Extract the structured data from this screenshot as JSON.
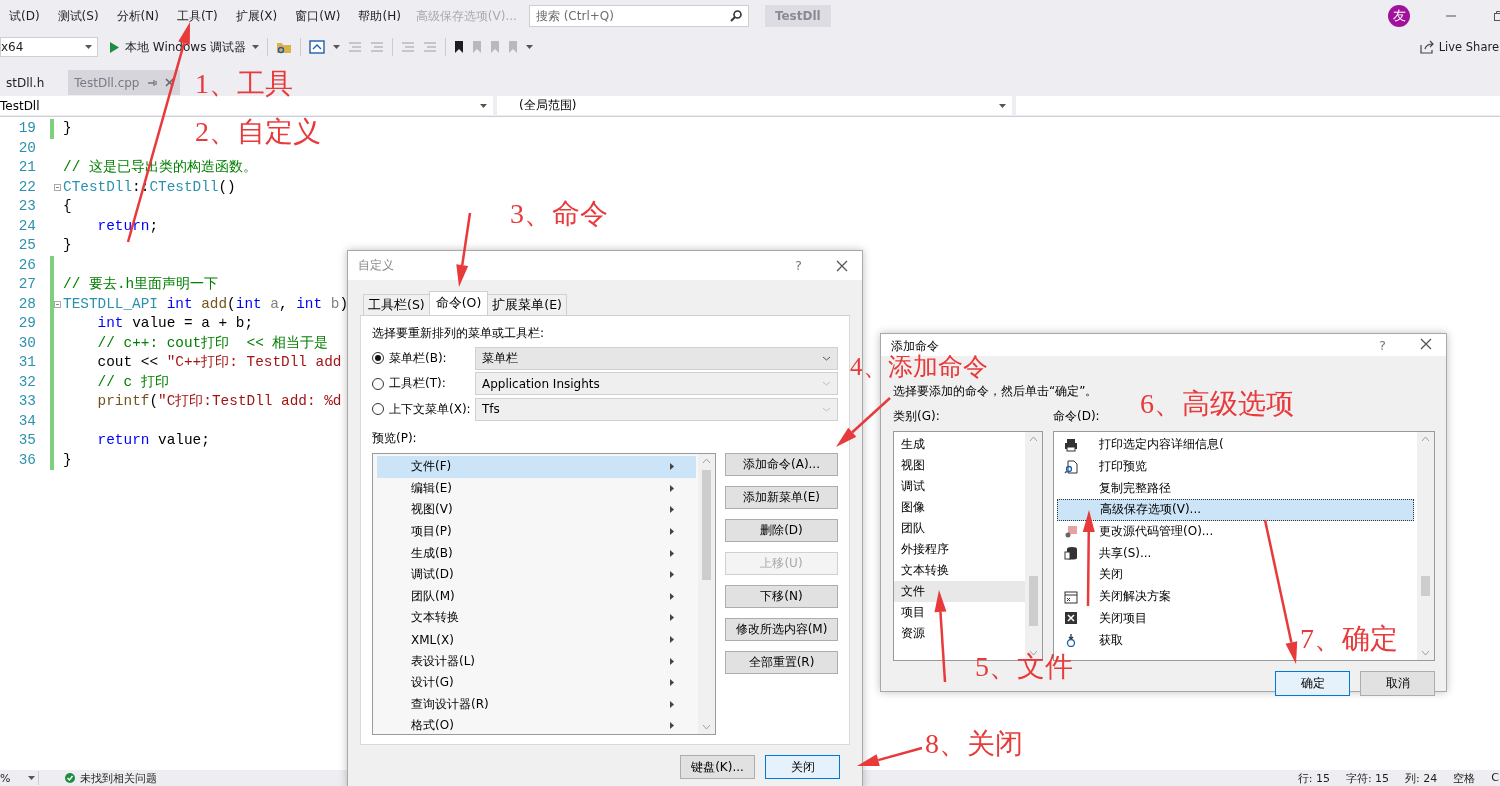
{
  "menubar": {
    "items": [
      "试(D)",
      "测试(S)",
      "分析(N)",
      "工具(T)",
      "扩展(X)",
      "窗口(W)",
      "帮助(H)"
    ],
    "extra_item": "高级保存选项(V)...",
    "search": {
      "placeholder": "搜索 (Ctrl+Q)"
    },
    "title": "TestDll",
    "avatar": "友"
  },
  "toolbar": {
    "platform": "x64",
    "run": "本地 Windows 调试器",
    "live_share": "Live Share"
  },
  "doc_tabs": [
    {
      "label": "stDll.h",
      "selected": false
    },
    {
      "label": "TestDll.cpp",
      "selected": true
    }
  ],
  "navbar": {
    "project": "TestDll",
    "scope": "(全局范围)"
  },
  "editor": {
    "lines": [
      {
        "number": "19",
        "changed": true,
        "collapsible": false,
        "indented": false,
        "tokens": [
          {
            "kind": "plain",
            "text": "}"
          }
        ]
      },
      {
        "number": "20",
        "changed": false,
        "collapsible": false
      },
      {
        "number": "21",
        "changed": false,
        "collapsible": false,
        "indented": false,
        "tokens": [
          {
            "kind": "comment",
            "text": "// 这是已导出类的构造函数。"
          }
        ]
      },
      {
        "number": "22",
        "changed": false,
        "collapsible": true,
        "indented": false,
        "tokens": [
          {
            "kind": "type",
            "text": "CTestDll"
          },
          {
            "kind": "plain",
            "text": "::"
          },
          {
            "kind": "type",
            "text": "CTestDll"
          },
          {
            "kind": "plain",
            "text": "()"
          }
        ]
      },
      {
        "number": "23",
        "changed": false,
        "collapsible": false,
        "indented": false,
        "tokens": [
          {
            "kind": "plain",
            "text": "{"
          }
        ]
      },
      {
        "number": "24",
        "changed": false,
        "collapsible": false,
        "indented": true,
        "tokens": [
          {
            "kind": "keyword",
            "text": "return"
          },
          {
            "kind": "plain",
            "text": ";"
          }
        ]
      },
      {
        "number": "25",
        "changed": false,
        "collapsible": false,
        "indented": false,
        "tokens": [
          {
            "kind": "plain",
            "text": "}"
          }
        ]
      },
      {
        "number": "26",
        "changed": true,
        "collapsible": false
      },
      {
        "number": "27",
        "changed": true,
        "collapsible": false,
        "indented": false,
        "tokens": [
          {
            "kind": "comment",
            "text": "// 要去.h里面声明一下"
          }
        ]
      },
      {
        "number": "28",
        "changed": true,
        "collapsible": true,
        "indented": false,
        "tokens": [
          {
            "kind": "type",
            "text": "TESTDLL_API "
          },
          {
            "kind": "keyword",
            "text": "int "
          },
          {
            "kind": "function",
            "text": "add"
          },
          {
            "kind": "plain",
            "text": "("
          },
          {
            "kind": "keyword",
            "text": "int "
          },
          {
            "kind": "param",
            "text": "a"
          },
          {
            "kind": "plain",
            "text": ", "
          },
          {
            "kind": "keyword",
            "text": "int "
          },
          {
            "kind": "param",
            "text": "b"
          },
          {
            "kind": "plain",
            "text": ")"
          }
        ]
      },
      {
        "number": "29",
        "changed": true,
        "collapsible": false,
        "indented": true,
        "tokens": [
          {
            "kind": "keyword",
            "text": "int"
          },
          {
            "kind": "plain",
            "text": " value = a + b;"
          }
        ]
      },
      {
        "number": "30",
        "changed": true,
        "collapsible": false,
        "indented": true,
        "tokens": [
          {
            "kind": "comment",
            "text": "// c++: cout打印  << 相当于是"
          }
        ]
      },
      {
        "number": "31",
        "changed": true,
        "collapsible": false,
        "indented": true,
        "tokens": [
          {
            "kind": "plain",
            "text": "cout << "
          },
          {
            "kind": "string",
            "text": "\"C++打印: TestDll add"
          }
        ]
      },
      {
        "number": "32",
        "changed": true,
        "collapsible": false,
        "indented": true,
        "tokens": [
          {
            "kind": "comment",
            "text": "// c 打印"
          }
        ]
      },
      {
        "number": "33",
        "changed": true,
        "collapsible": false,
        "indented": true,
        "tokens": [
          {
            "kind": "function",
            "text": "printf"
          },
          {
            "kind": "plain",
            "text": "("
          },
          {
            "kind": "string",
            "text": "\"C打印:TestDll add: %d"
          }
        ]
      },
      {
        "number": "34",
        "changed": true,
        "collapsible": false
      },
      {
        "number": "35",
        "changed": true,
        "collapsible": false,
        "indented": true,
        "tokens": [
          {
            "kind": "keyword",
            "text": "return"
          },
          {
            "kind": "plain",
            "text": " value;"
          }
        ]
      },
      {
        "number": "36",
        "changed": true,
        "collapsible": false,
        "indented": false,
        "tokens": [
          {
            "kind": "plain",
            "text": "}"
          }
        ]
      }
    ]
  },
  "status_bar": {
    "zoom": "%",
    "issues": "未找到相关问题",
    "line": "行: 15",
    "char": "字符: 15",
    "col": "列: 24",
    "spaces": "空格",
    "ending": "C"
  },
  "customize_dialog": {
    "title": "自定义",
    "help": "?",
    "tabs": [
      {
        "label": "工具栏(S)",
        "selected": false
      },
      {
        "label": "命令(O)",
        "selected": true
      },
      {
        "label": "扩展菜单(E)",
        "selected": false
      }
    ],
    "prompt": "选择要重新排列的菜单或工具栏:",
    "targets": [
      {
        "label": "菜单栏(B):",
        "value": "菜单栏",
        "selected": true,
        "disabled": false
      },
      {
        "label": "工具栏(T):",
        "value": "Application Insights",
        "selected": false,
        "disabled": true
      },
      {
        "label": "上下文菜单(X):",
        "value": "Tfs",
        "selected": false,
        "disabled": true
      }
    ],
    "preview_label": "预览(P):",
    "preview_items": [
      {
        "label": "文件(F)",
        "selected": true
      },
      {
        "label": "编辑(E)",
        "selected": false
      },
      {
        "label": "视图(V)",
        "selected": false
      },
      {
        "label": "项目(P)",
        "selected": false
      },
      {
        "label": "生成(B)",
        "selected": false
      },
      {
        "label": "调试(D)",
        "selected": false
      },
      {
        "label": "团队(M)",
        "selected": false
      },
      {
        "label": "文本转换",
        "selected": false
      },
      {
        "label": "XML(X)",
        "selected": false
      },
      {
        "label": "表设计器(L)",
        "selected": false
      },
      {
        "label": "设计(G)",
        "selected": false
      },
      {
        "label": "查询设计器(R)",
        "selected": false
      },
      {
        "label": "格式(O)",
        "selected": false
      }
    ],
    "buttons": [
      {
        "label": "添加命令(A)...",
        "disabled": false
      },
      {
        "label": "添加新菜单(E)",
        "disabled": false
      },
      {
        "label": "删除(D)",
        "disabled": false
      },
      {
        "label": "上移(U)",
        "disabled": true
      },
      {
        "label": "下移(N)",
        "disabled": false
      },
      {
        "label": "修改所选内容(M)",
        "disabled": false
      },
      {
        "label": "全部重置(R)",
        "disabled": false
      }
    ],
    "footer_buttons": [
      {
        "label": "键盘(K)...",
        "default": false
      },
      {
        "label": "关闭",
        "default": true
      }
    ]
  },
  "add_command_dialog": {
    "title": "添加命令",
    "help": "?",
    "prompt": "选择要添加的命令，然后单击“确定”。",
    "categories_label": "类别(G):",
    "categories": [
      {
        "label": "生成",
        "selected": false
      },
      {
        "label": "视图",
        "selected": false
      },
      {
        "label": "调试",
        "selected": false
      },
      {
        "label": "图像",
        "selected": false
      },
      {
        "label": "团队",
        "selected": false
      },
      {
        "label": "外接程序",
        "selected": false
      },
      {
        "label": "文本转换",
        "selected": false
      },
      {
        "label": "文件",
        "selected": true
      },
      {
        "label": "项目",
        "selected": false
      },
      {
        "label": "资源",
        "selected": false
      }
    ],
    "commands_label": "命令(D):",
    "commands": [
      {
        "label": "打印选定内容详细信息(",
        "kind": "print",
        "selected": false
      },
      {
        "label": "打印预览",
        "kind": "preview",
        "selected": false
      },
      {
        "label": "复制完整路径",
        "kind": "plain",
        "selected": false
      },
      {
        "label": "高级保存选项(V)...",
        "kind": "plain",
        "selected": true
      },
      {
        "label": "更改源代码管理(O)...",
        "kind": "source",
        "selected": false
      },
      {
        "label": "共享(S)...",
        "kind": "share",
        "selected": false
      },
      {
        "label": "关闭",
        "kind": "plain",
        "selected": false
      },
      {
        "label": "关闭解决方案",
        "kind": "solution",
        "selected": false
      },
      {
        "label": "关闭项目",
        "kind": "closebox",
        "selected": false
      },
      {
        "label": "获取",
        "kind": "get",
        "selected": false
      }
    ],
    "buttons": [
      {
        "label": "确定",
        "default": true
      },
      {
        "label": "取消",
        "default": false
      }
    ]
  },
  "annotations": [
    {
      "text": "1、工具"
    },
    {
      "text": "2、自定义"
    },
    {
      "text": "3、命令"
    },
    {
      "text": "4、添加命令"
    },
    {
      "text": "5、文件"
    },
    {
      "text": "6、高级选项"
    },
    {
      "text": "7、确定"
    },
    {
      "text": "8、关闭"
    }
  ]
}
